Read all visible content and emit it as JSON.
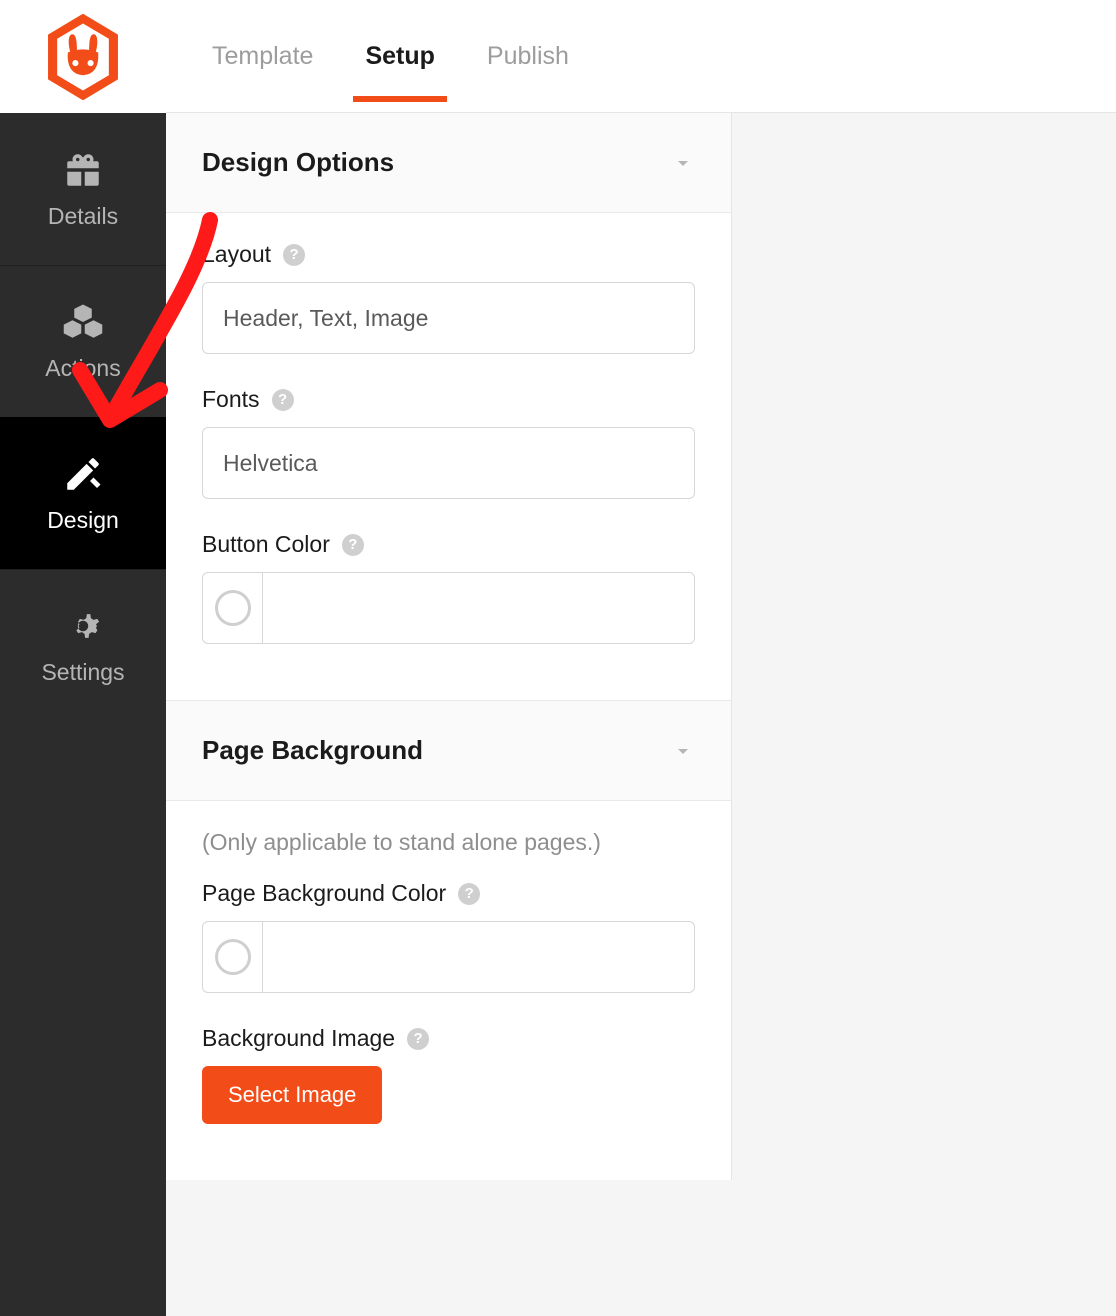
{
  "colors": {
    "accent": "#f24c18"
  },
  "sidebar": {
    "items": [
      {
        "label": "Details",
        "icon": "gift"
      },
      {
        "label": "Actions",
        "icon": "cubes"
      },
      {
        "label": "Design",
        "icon": "design"
      },
      {
        "label": "Settings",
        "icon": "gear"
      }
    ]
  },
  "tabs": [
    {
      "label": "Template"
    },
    {
      "label": "Setup"
    },
    {
      "label": "Publish"
    }
  ],
  "sections": {
    "designOptions": {
      "title": "Design Options",
      "layout": {
        "label": "Layout",
        "value": "Header, Text, Image"
      },
      "fonts": {
        "label": "Fonts",
        "value": "Helvetica"
      },
      "buttonColor": {
        "label": "Button Color",
        "value": ""
      }
    },
    "pageBackground": {
      "title": "Page Background",
      "hint": "(Only applicable to stand alone pages.)",
      "bgColor": {
        "label": "Page Background Color",
        "value": ""
      },
      "bgImage": {
        "label": "Background Image",
        "button": "Select Image"
      }
    }
  }
}
